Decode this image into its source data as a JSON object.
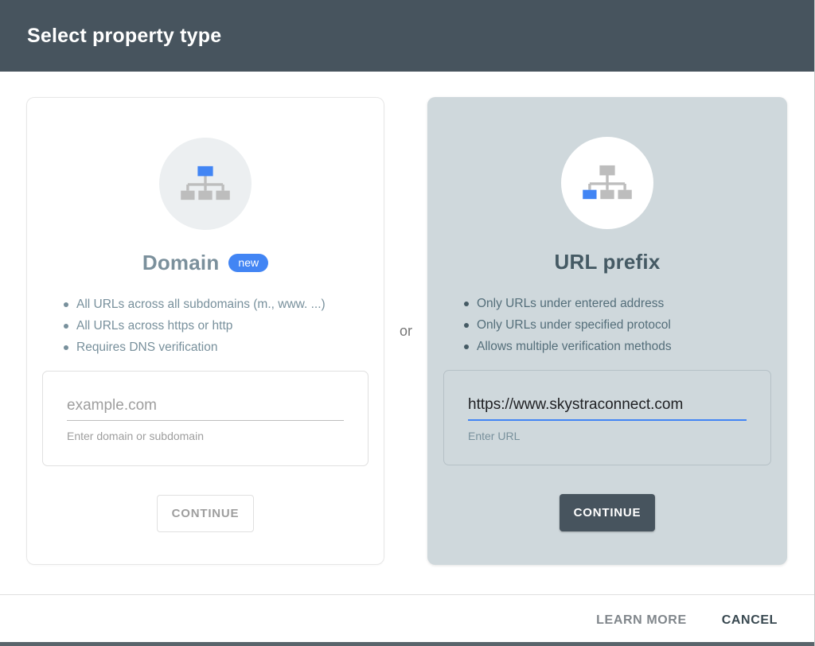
{
  "header": {
    "title": "Select property type"
  },
  "or_label": "or",
  "domain_card": {
    "title": "Domain",
    "badge": "new",
    "icon": "site-tree-icon-root-highlighted",
    "bullets": [
      "All URLs across all subdomains (m., www. ...)",
      "All URLs across https or http",
      "Requires DNS verification"
    ],
    "input": {
      "value": "",
      "placeholder": "example.com",
      "helper": "Enter domain or subdomain"
    },
    "continue_label": "CONTINUE"
  },
  "url_prefix_card": {
    "title": "URL prefix",
    "icon": "site-tree-icon-leaf-highlighted",
    "bullets": [
      "Only URLs under entered address",
      "Only URLs under specified protocol",
      "Allows multiple verification methods"
    ],
    "input": {
      "value": "https://www.skystraconnect.com",
      "helper": "Enter URL"
    },
    "continue_label": "CONTINUE"
  },
  "footer": {
    "learn_more_label": "LEARN MORE",
    "cancel_label": "CANCEL"
  },
  "colors": {
    "header_bg": "#47545e",
    "accent_blue": "#4285f4",
    "url_card_bg": "#cfd8dc",
    "domain_circle_bg": "#eceff1",
    "domain_title": "#7b909c",
    "url_title": "#455a64",
    "icon_gray": "#bdbdbd",
    "primary_button_bg": "#47545e",
    "cancel_text": "#37474f"
  }
}
